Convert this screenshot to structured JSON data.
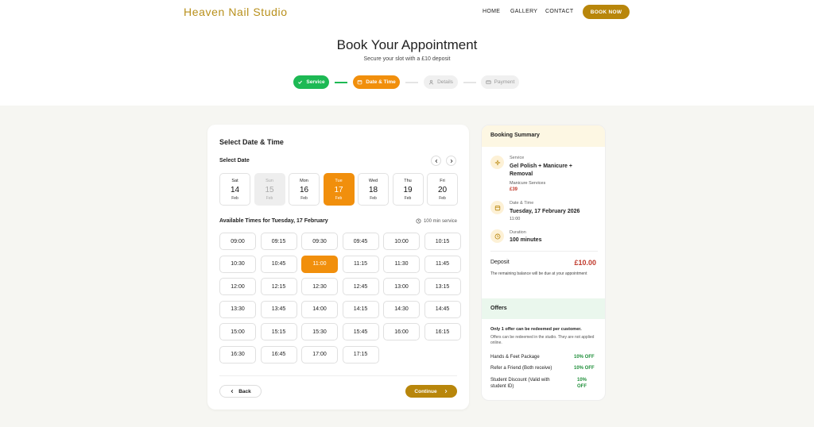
{
  "nav": {
    "brand": "Heaven Nail Studio",
    "links": [
      "HOME",
      "GALLERY",
      "CONTACT"
    ],
    "cta": "BOOK NOW"
  },
  "hero": {
    "title": "Book Your Appointment",
    "subtitle": "Secure your slot with a £10 deposit"
  },
  "steps": [
    {
      "label": "Service",
      "state": "done",
      "icon": "check-icon"
    },
    {
      "label": "Date & Time",
      "state": "active",
      "icon": "calendar-icon"
    },
    {
      "label": "Details",
      "state": "pending",
      "icon": "user-icon"
    },
    {
      "label": "Payment",
      "state": "pending",
      "icon": "card-icon"
    }
  ],
  "colors": {
    "accent": "#f18f0c",
    "brand": "#b8860b",
    "done": "#1db954",
    "price": "#c0392b",
    "offer": "#1f8f3a"
  },
  "picker": {
    "title": "Select Date & Time",
    "select_date_label": "Select Date",
    "days": [
      {
        "name": "Sat",
        "date": "14",
        "month": "Feb",
        "state": "normal"
      },
      {
        "name": "Sun",
        "date": "15",
        "month": "Feb",
        "state": "disabled"
      },
      {
        "name": "Mon",
        "date": "16",
        "month": "Feb",
        "state": "normal"
      },
      {
        "name": "Tue",
        "date": "17",
        "month": "Feb",
        "state": "selected"
      },
      {
        "name": "Wed",
        "date": "18",
        "month": "Feb",
        "state": "normal"
      },
      {
        "name": "Thu",
        "date": "19",
        "month": "Feb",
        "state": "normal"
      },
      {
        "name": "Fri",
        "date": "20",
        "month": "Feb",
        "state": "normal"
      }
    ],
    "available_label": "Available Times for Tuesday, 17 February",
    "duration_label": "100 min service",
    "times": [
      "09:00",
      "09:15",
      "09:30",
      "09:45",
      "10:00",
      "10:15",
      "10:30",
      "10:45",
      "11:00",
      "11:15",
      "11:30",
      "11:45",
      "12:00",
      "12:15",
      "12:30",
      "12:45",
      "13:00",
      "13:15",
      "13:30",
      "13:45",
      "14:00",
      "14:15",
      "14:30",
      "14:45",
      "15:00",
      "15:15",
      "15:30",
      "15:45",
      "16:00",
      "16:15",
      "16:30",
      "16:45",
      "17:00",
      "17:15"
    ],
    "selected_time": "11:00",
    "back_label": "Back",
    "continue_label": "Continue"
  },
  "summary": {
    "title": "Booking Summary",
    "service_label": "Service",
    "service_value": "Gel Polish + Manicure + Removal",
    "service_category": "Manicure Services",
    "service_price": "£39",
    "datetime_label": "Date & Time",
    "datetime_value": "Tuesday, 17 February 2026",
    "time_value": "11:00",
    "duration_label": "Duration",
    "duration_value": "100 minutes",
    "deposit_label": "Deposit",
    "deposit_amount": "£10.00",
    "deposit_note": "The remaining balance will be due at your appointment"
  },
  "offers": {
    "title": "Offers",
    "note_bold": "Only 1 offer can be redeemed per customer.",
    "note": "Offers can be redeemed in the studio. They are not applied online.",
    "items": [
      {
        "name": "Hands & Feet Package",
        "value": "10% OFF"
      },
      {
        "name": "Refer a Friend (Both receive)",
        "value": "10% OFF"
      },
      {
        "name": "Student Discount (Valid with student ID)",
        "value": "10% OFF"
      }
    ]
  }
}
